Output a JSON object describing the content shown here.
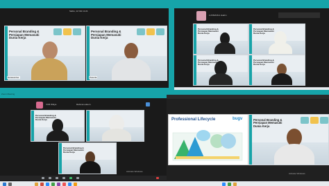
{
  "top_left": {
    "header_text": "Sabtu, 12 Okt 14.21",
    "tile1": {
      "title_line1": "Personal Branding &",
      "title_line2": "Persiapan Memasuki",
      "title_line3": "Dunia Kerja",
      "name": "Narasumber"
    },
    "tile2": {
      "title_line1": "Personal Branding &",
      "title_line2": "Persiapan Memasuki",
      "title_line3": "Dunia Kerja",
      "name": "Peserta"
    }
  },
  "top_right": {
    "header_name": "LUKMANUL Hakim",
    "tiles": [
      {
        "title_line1": "Personal Branding &",
        "title_line2": "Persiapan Memasuki",
        "title_line3": "Dunia Kerja"
      },
      {
        "title_line1": "Personal Branding &",
        "title_line2": "Persiapan Memasuki",
        "title_line3": "Dunia Kerja"
      },
      {
        "title_line1": "Personal Branding &",
        "title_line2": "Persiapan Memasuki",
        "title_line3": "Dunia Kerja"
      },
      {
        "title_line1": "Personal Branding &",
        "title_line2": "Persiapan Memasuki",
        "title_line3": "Dunia Kerja"
      }
    ]
  },
  "bottom_left": {
    "header_name": "VCB Widya",
    "header_name2": "Rahmat  edas A.",
    "tiles": [
      {
        "title_line1": "Personal Branding &",
        "title_line2": "Persiapan Memasuki",
        "title_line3": "Dunia Kerja"
      },
      {
        "title_line1": "Personal Branding &",
        "title_line2": "Persiapan Memasuki",
        "title_line3": "Dunia Kerja"
      },
      {
        "title_line1": "Personal Branding &",
        "title_line2": "Persiapan Memasuki",
        "title_line3": "Dunia Kerja"
      }
    ],
    "activate_windows": "Activate Windows"
  },
  "bottom_right": {
    "slide_title": "Professional Lifecycle",
    "brand": "bugv",
    "tile": {
      "title_line1": "Personal Branding &",
      "title_line2": "Persiapan Memasuki",
      "title_line3": "Dunia Kerja"
    },
    "activate_windows": "Activate Windows"
  },
  "left_small_label": "Zoom Meeting",
  "colors": {
    "teal": "#16a4a9",
    "banner_title": "#222222"
  }
}
